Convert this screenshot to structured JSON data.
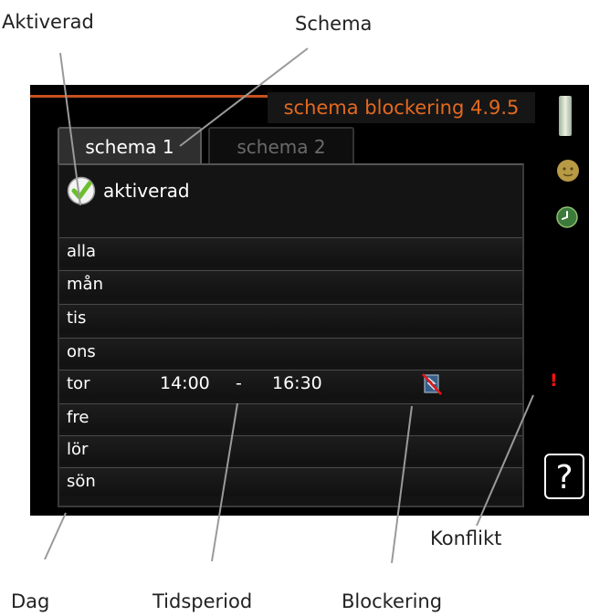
{
  "callouts": {
    "activated": "Aktiverad",
    "schedule": "Schema",
    "conflict": "Konflikt",
    "day": "Dag",
    "time_period": "Tidsperiod",
    "blocking": "Blockering"
  },
  "screen": {
    "title": "schema blockering 4.9.5",
    "accent_color": "#e3691f",
    "tabs": [
      {
        "label": "schema 1",
        "active": true
      },
      {
        "label": "schema 2",
        "active": false
      }
    ],
    "activated_label": "aktiverad",
    "activated_checked": true,
    "days": [
      {
        "label": "alla",
        "start": "",
        "sep": "",
        "end": "",
        "blocked": false
      },
      {
        "label": "mån",
        "start": "",
        "sep": "",
        "end": "",
        "blocked": false
      },
      {
        "label": "tis",
        "start": "",
        "sep": "",
        "end": "",
        "blocked": false
      },
      {
        "label": "ons",
        "start": "",
        "sep": "",
        "end": "",
        "blocked": false
      },
      {
        "label": "tor",
        "start": "14:00",
        "sep": "-",
        "end": "16:30",
        "blocked": true,
        "conflict": true
      },
      {
        "label": "fre",
        "start": "",
        "sep": "",
        "end": "",
        "blocked": false
      },
      {
        "label": "lör",
        "start": "",
        "sep": "",
        "end": "",
        "blocked": false
      },
      {
        "label": "sön",
        "start": "",
        "sep": "",
        "end": "",
        "blocked": false
      }
    ],
    "conflict_mark": "!",
    "help_label": "?",
    "icons": {
      "check": "check-icon",
      "blocking": "blocked-heater-icon",
      "smiley": "smiley-icon",
      "clock": "clock-icon",
      "scroll": "scrollbar"
    }
  }
}
